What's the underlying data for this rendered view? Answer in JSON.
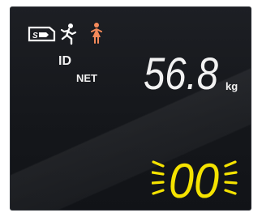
{
  "display": {
    "labels": {
      "id": "ID",
      "net": "NET"
    },
    "weight": {
      "value": "56.8",
      "unit": "kg"
    },
    "code": {
      "value": "00"
    }
  },
  "icons": [
    {
      "name": "sd-card-icon",
      "color": "#ffffff"
    },
    {
      "name": "running-person-icon",
      "color": "#ffffff"
    },
    {
      "name": "standing-person-icon",
      "color": "#f58a5a"
    },
    {
      "name": "blink-rays-icon",
      "color": "#f5e300"
    }
  ],
  "colors": {
    "screen": "#17191d",
    "segment_white": "#f2f2f2",
    "segment_yellow": "#f5e300",
    "accent_orange": "#f58a5a"
  }
}
